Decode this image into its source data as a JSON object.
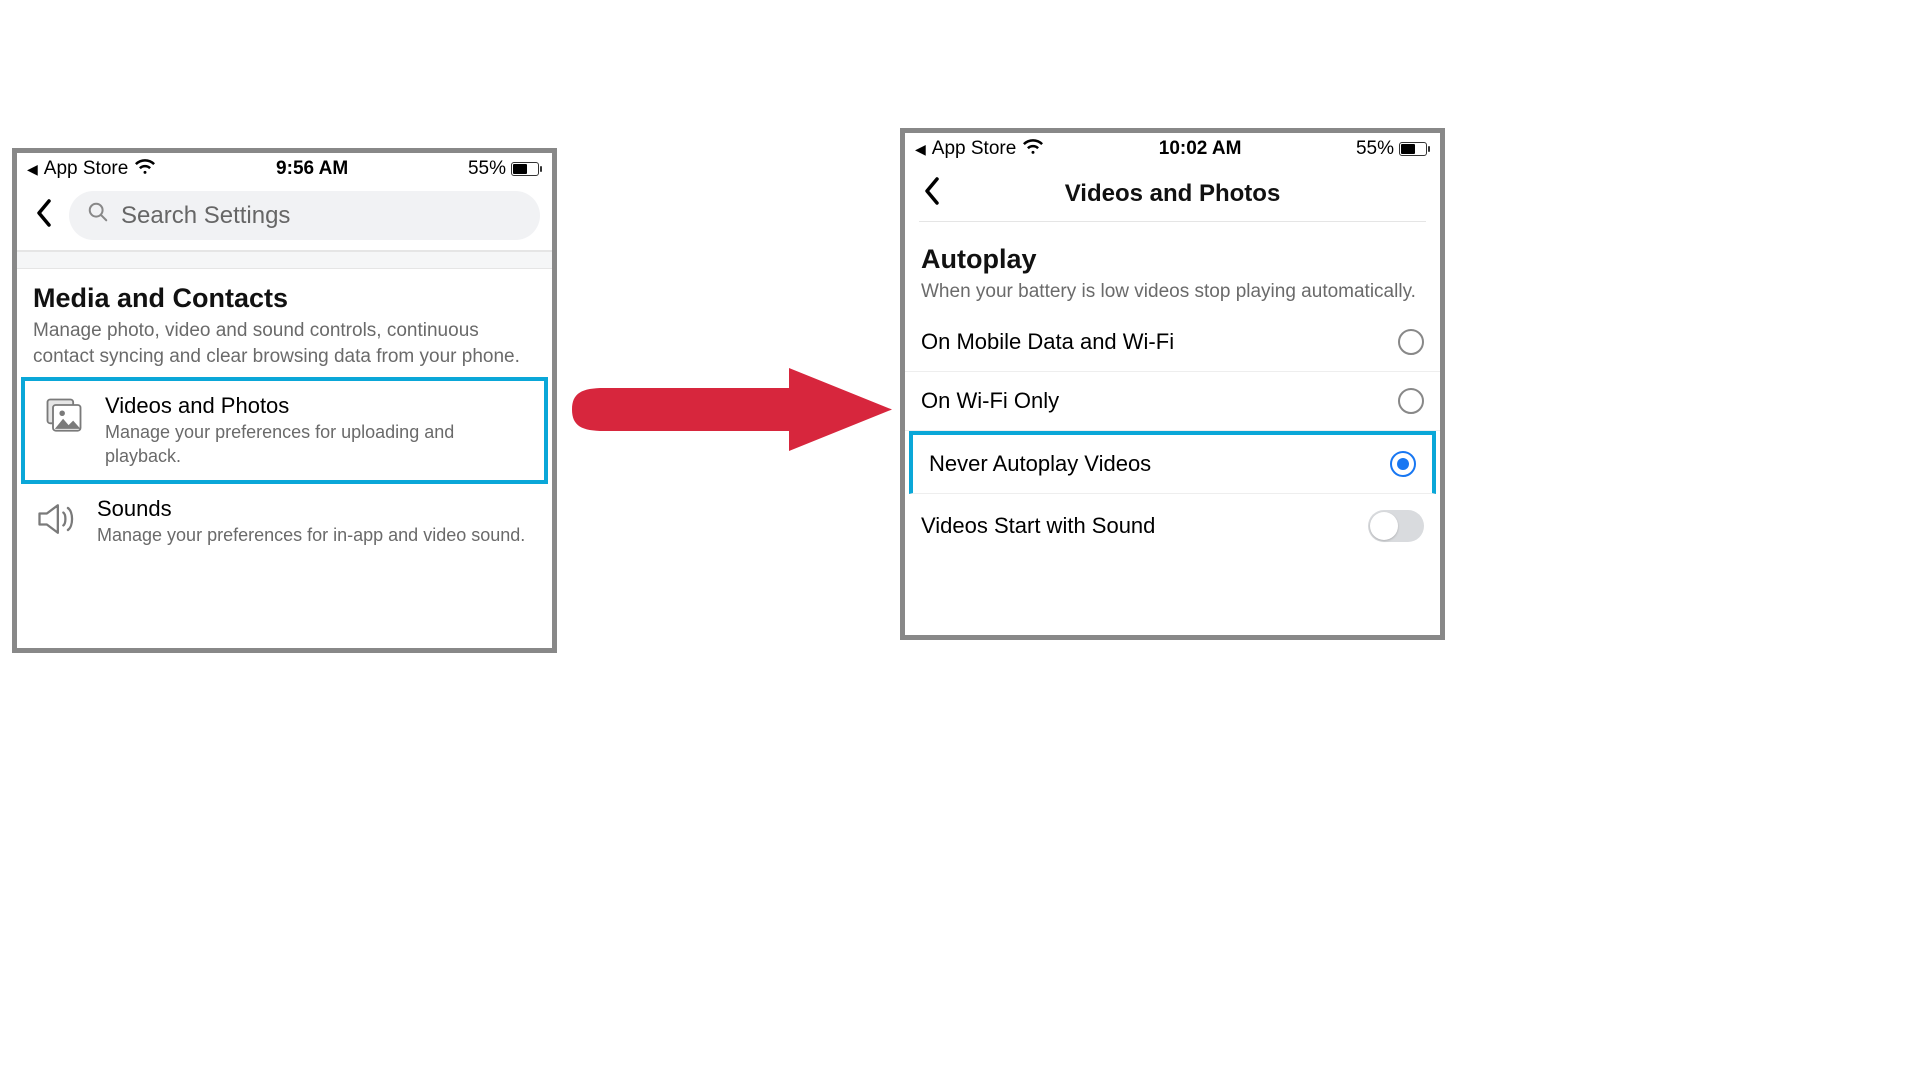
{
  "left": {
    "status": {
      "back_app": "App Store",
      "time": "9:56 AM",
      "battery": "55%"
    },
    "search_placeholder": "Search Settings",
    "section": {
      "title": "Media and Contacts",
      "desc": "Manage photo, video and sound controls, continuous contact syncing and clear browsing data from your phone."
    },
    "items": [
      {
        "icon": "photos",
        "title": "Videos and Photos",
        "desc": "Manage your preferences for uploading and playback.",
        "highlighted": true
      },
      {
        "icon": "sounds",
        "title": "Sounds",
        "desc": "Manage your preferences for in-app and video sound.",
        "highlighted": false
      }
    ]
  },
  "right": {
    "status": {
      "back_app": "App Store",
      "time": "10:02 AM",
      "battery": "55%"
    },
    "title": "Videos and Photos",
    "autoplay": {
      "heading": "Autoplay",
      "desc": "When your battery is low videos stop playing automatically.",
      "options": [
        {
          "label": "On Mobile Data and Wi-Fi",
          "selected": false,
          "highlighted": false
        },
        {
          "label": "On Wi-Fi Only",
          "selected": false,
          "highlighted": false
        },
        {
          "label": "Never Autoplay Videos",
          "selected": true,
          "highlighted": true
        }
      ]
    },
    "sound_toggle": {
      "label": "Videos Start with Sound",
      "on": false
    }
  }
}
